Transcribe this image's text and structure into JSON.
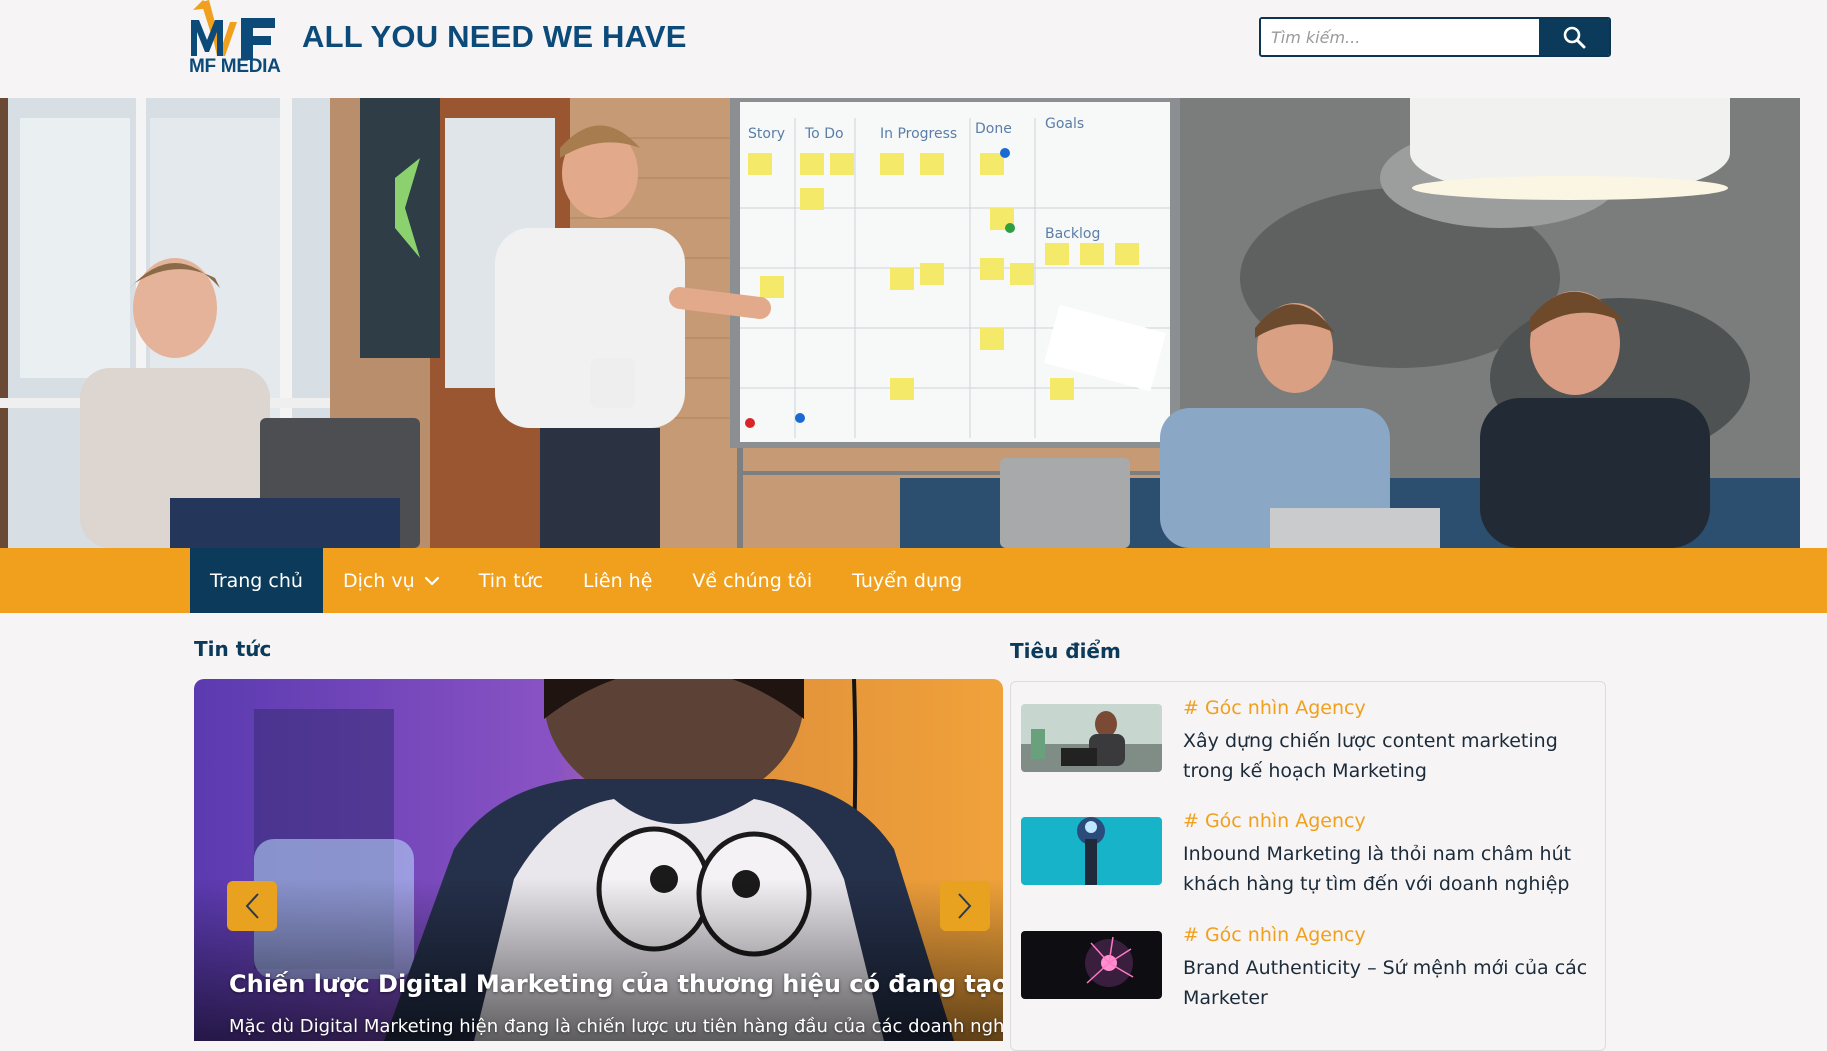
{
  "brand": {
    "logo_text": "MF MEDIA",
    "tagline": "ALL YOU NEED WE HAVE",
    "primary_color": "#0b4a79",
    "accent_color": "#f0a01d"
  },
  "search": {
    "placeholder": "Tìm kiếm...",
    "icon": "search-icon"
  },
  "hero": {
    "whiteboard_columns": [
      "Story",
      "To Do",
      "In Progress",
      "Done",
      "Goals"
    ],
    "whiteboard_backlog": "Backlog"
  },
  "nav": {
    "items": [
      {
        "label": "Trang chủ",
        "active": true
      },
      {
        "label": "Dịch vụ",
        "has_dropdown": true
      },
      {
        "label": "Tin tức"
      },
      {
        "label": "Liên hệ"
      },
      {
        "label": "Về chúng tôi"
      },
      {
        "label": "Tuyển dụng"
      }
    ]
  },
  "news": {
    "section_title": "Tin tức",
    "slide": {
      "title": "Chiến lược Digital Marketing của thương hiệu có đang tạo ra giá t",
      "excerpt": "Mặc dù Digital Marketing hiện đang là chiến lược ưu tiên hàng đầu của các doanh nghiệp"
    }
  },
  "featured": {
    "section_title": "Tiêu điểm",
    "items": [
      {
        "category": "# Góc nhìn Agency",
        "title": "Xây dựng chiến lược content marketing trong kế hoạch Marketing"
      },
      {
        "category": "# Góc nhìn Agency",
        "title": "Inbound Marketing là thỏi nam châm hút khách hàng tự tìm đến với doanh nghiệp"
      },
      {
        "category": "# Góc nhìn Agency",
        "title": "Brand Authenticity – Sứ mệnh mới của các Marketer"
      }
    ]
  }
}
